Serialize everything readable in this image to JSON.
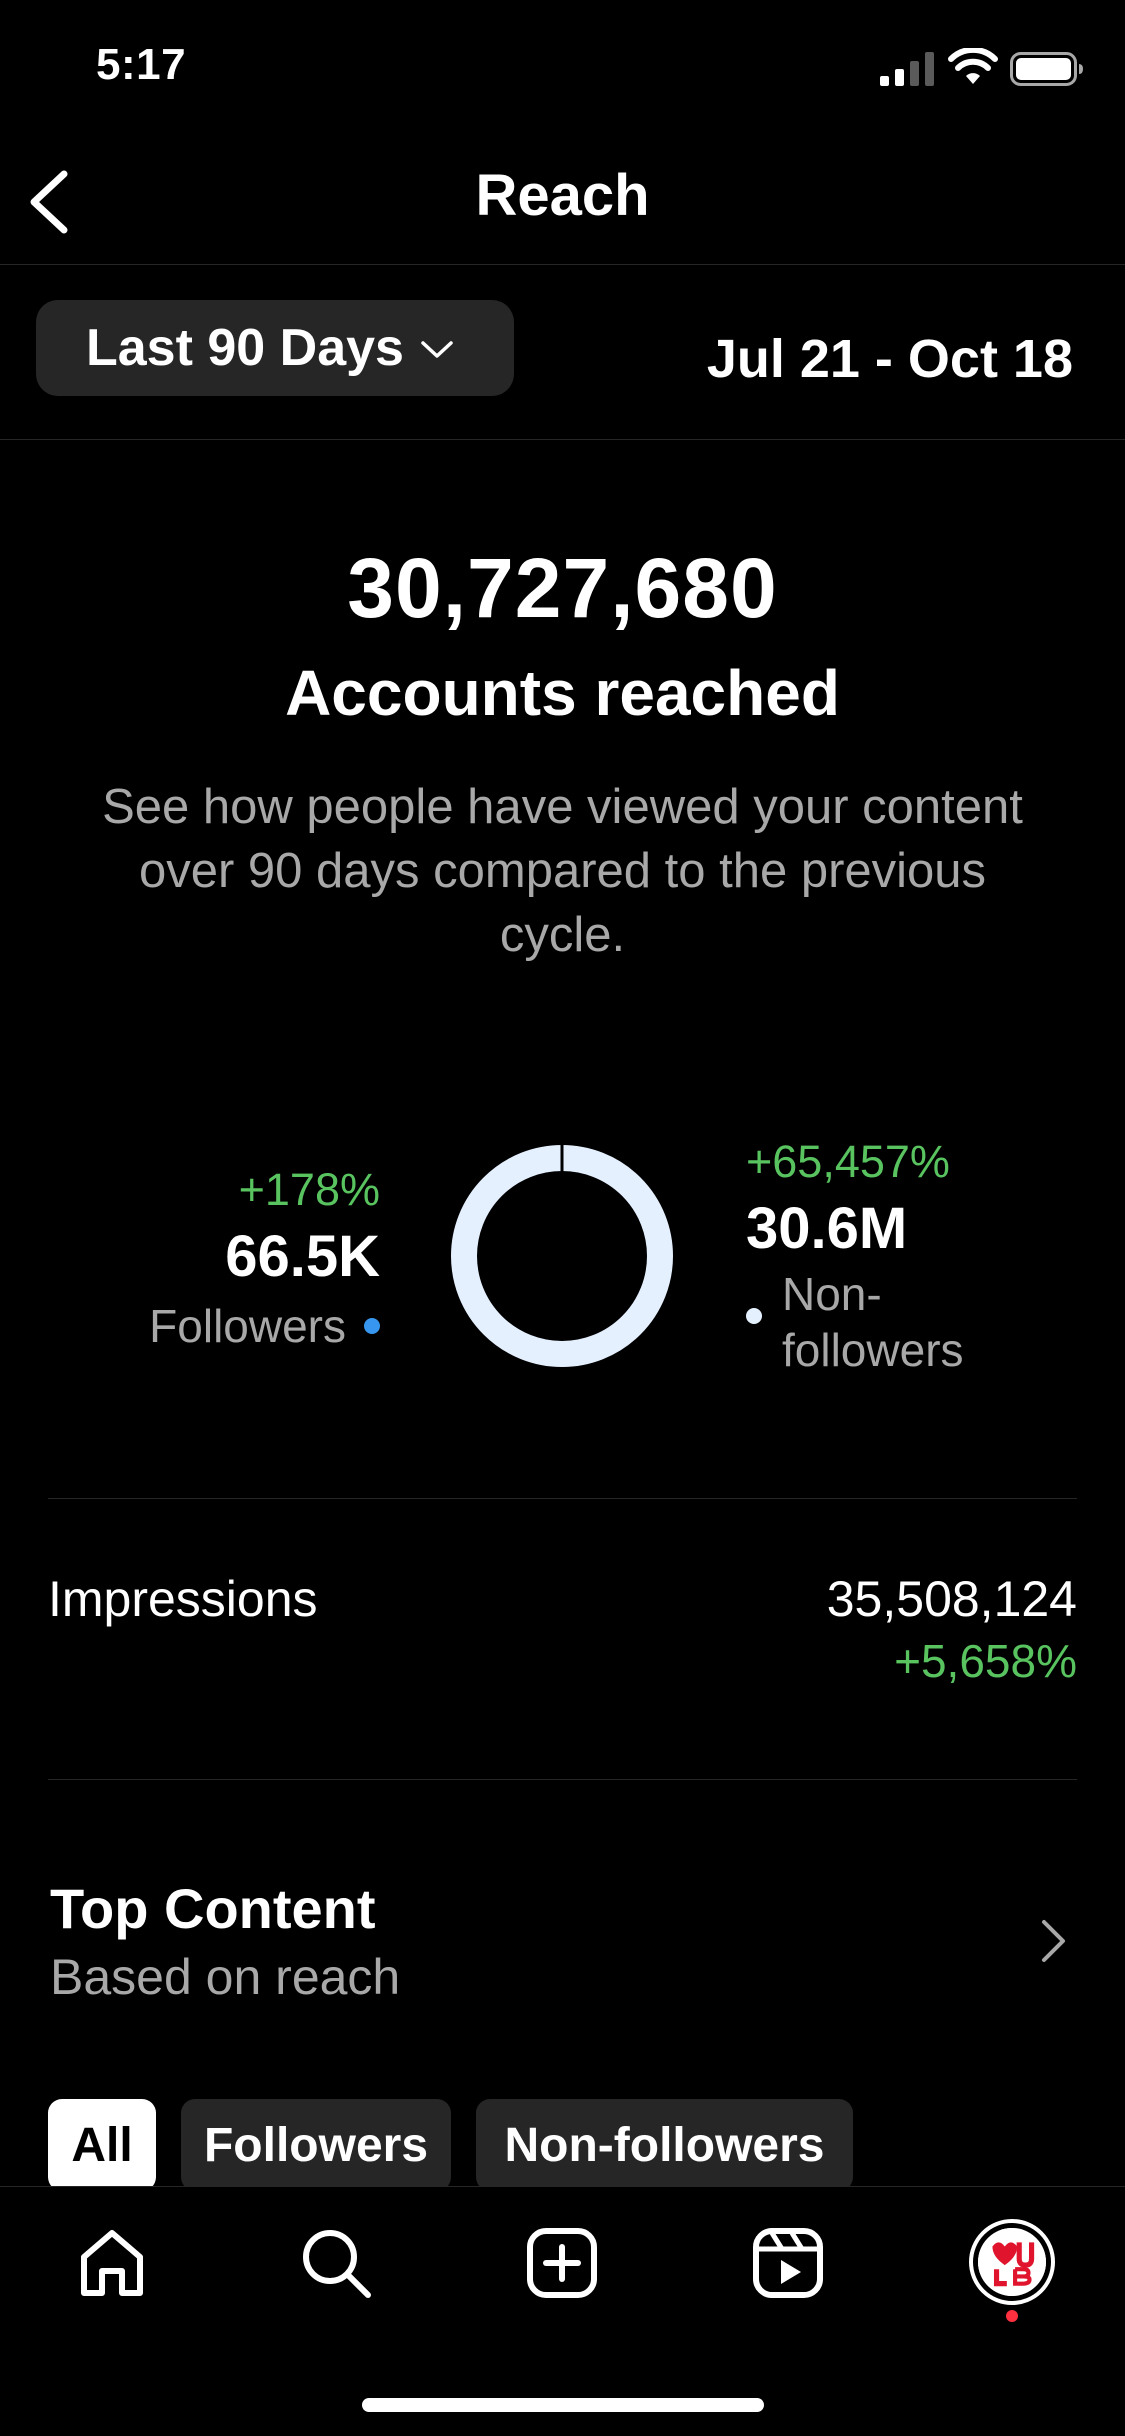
{
  "status_bar": {
    "time": "5:17"
  },
  "header": {
    "title": "Reach"
  },
  "filter": {
    "range_label": "Last 90 Days",
    "date_range": "Jul 21 - Oct 18"
  },
  "summary": {
    "value": "30,727,680",
    "label": "Accounts reached",
    "description": "See how people have viewed your content over 90 days compared to the previous cycle."
  },
  "breakdown": {
    "followers": {
      "change": "+178%",
      "value": "66.5K",
      "label": "Followers",
      "color": "#3797f0"
    },
    "non_followers": {
      "change": "+65,457%",
      "value": "30.6M",
      "label": "Non-followers",
      "color": "#e5f0ff"
    }
  },
  "impressions": {
    "label": "Impressions",
    "value": "35,508,124",
    "change": "+5,658%"
  },
  "top_content": {
    "title": "Top Content",
    "subtitle": "Based on reach"
  },
  "chips": [
    {
      "label": "All",
      "selected": true
    },
    {
      "label": "Followers",
      "selected": false
    },
    {
      "label": "Non-followers",
      "selected": false
    }
  ],
  "tab_bar": {
    "icons": [
      "home-icon",
      "search-icon",
      "create-icon",
      "reels-icon",
      "profile-avatar"
    ]
  },
  "colors": {
    "positive": "#58c35f",
    "secondary_text": "#a8a8a8",
    "surface": "#262626"
  }
}
